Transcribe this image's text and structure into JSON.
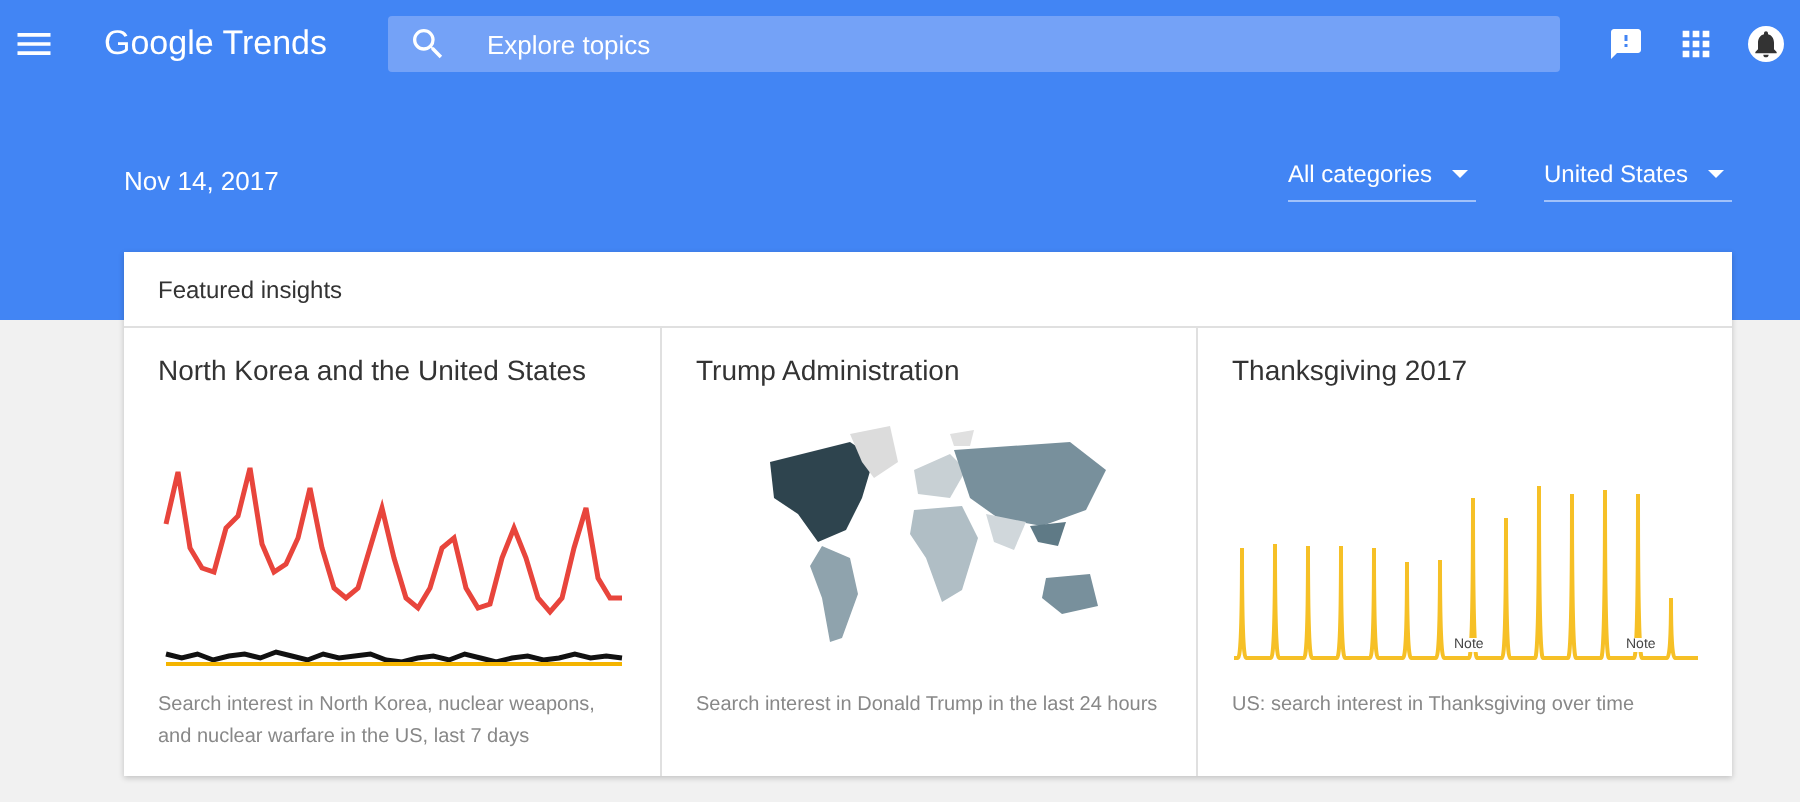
{
  "app_bar": {
    "logo": "Google Trends",
    "search": {
      "placeholder": "Explore topics"
    }
  },
  "date": "Nov 14, 2017",
  "filters": [
    {
      "label": "All categories"
    },
    {
      "label": "United States"
    }
  ],
  "featured": {
    "title": "Featured insights",
    "cards": [
      {
        "kind": "line",
        "title": "North Korea and the United States",
        "caption": "Search interest in North Korea, nuclear weapons, and nuclear warfare in the US, last 7 days"
      },
      {
        "kind": "map",
        "title": "Trump Administration",
        "caption": "Search interest in Donald Trump in the last 24 hours"
      },
      {
        "kind": "spikes",
        "title": "Thanksgiving 2017",
        "caption": "US: search interest in Thanksgiving over time",
        "notes": [
          "Note",
          "Note"
        ]
      }
    ]
  }
}
